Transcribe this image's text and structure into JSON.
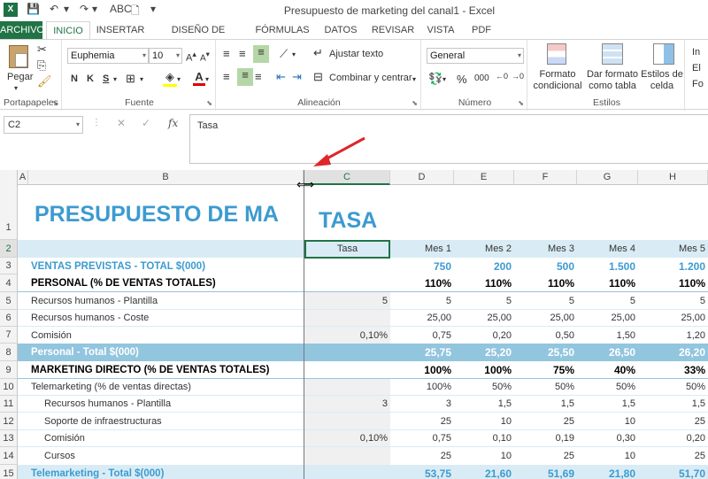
{
  "window": {
    "title": "Presupuesto de marketing del canal1 - Excel"
  },
  "quick_access": {
    "app_icon": "X",
    "save_icon": "💾",
    "undo_icon": "↶",
    "redo_icon": "↷",
    "spell_icon": "ABC",
    "newdoc_icon": "🗋",
    "dropdown": "▾"
  },
  "tabs": [
    "ARCHIVO",
    "INICIO",
    "INSERTAR",
    "DISEÑO DE PÁGINA",
    "FÓRMULAS",
    "DATOS",
    "REVISAR",
    "VISTA",
    "PDF"
  ],
  "ribbon": {
    "portapapeles": {
      "label": "Portapapeles",
      "paste": "Pegar"
    },
    "fuente": {
      "label": "Fuente",
      "font": "Euphemia",
      "size": "10",
      "bold": "N",
      "italic": "K",
      "underline": "S"
    },
    "alineacion": {
      "label": "Alineación",
      "wrap": "Ajustar texto",
      "merge": "Combinar y centrar"
    },
    "numero": {
      "label": "Número",
      "format": "General",
      "percent": "%",
      "thousands": "000"
    },
    "estilos": {
      "label": "Estilos",
      "cond": "Formato condicional",
      "table": "Dar formato como tabla",
      "cellstyles": "Estilos de celda"
    },
    "celdas": {
      "insert": "In",
      "delete": "El",
      "format": "Fo"
    }
  },
  "formula_bar": {
    "namebox": "C2",
    "fx": "fx",
    "content": "Tasa"
  },
  "columns": [
    "A",
    "B",
    "C",
    "D",
    "E",
    "F",
    "G",
    "H"
  ],
  "rows": [
    "1",
    "2",
    "3",
    "4",
    "5",
    "6",
    "7",
    "8",
    "9",
    "10",
    "11",
    "12",
    "13",
    "14",
    "15"
  ],
  "sheet": {
    "title": "PRESUPUESTO DE MA",
    "tasa_title": "TASA",
    "r2": {
      "c": "Tasa",
      "d": "Mes 1",
      "e": "Mes 2",
      "f": "Mes 3",
      "g": "Mes 4",
      "h": "Mes 5"
    },
    "r3": {
      "b": "VENTAS PREVISTAS - TOTAL $(000)",
      "d": "750",
      "e": "200",
      "f": "500",
      "g": "1.500",
      "h": "1.200"
    },
    "r4": {
      "b": "PERSONAL (% DE VENTAS TOTALES)",
      "d": "110%",
      "e": "110%",
      "f": "110%",
      "g": "110%",
      "h": "110%"
    },
    "r5": {
      "b": "Recursos humanos - Plantilla",
      "c": "5",
      "d": "5",
      "e": "5",
      "f": "5",
      "g": "5",
      "h": "5"
    },
    "r6": {
      "b": "Recursos humanos - Coste",
      "d": "25,00",
      "e": "25,00",
      "f": "25,00",
      "g": "25,00",
      "h": "25,00"
    },
    "r7": {
      "b": "Comisión",
      "c": "0,10%",
      "d": "0,75",
      "e": "0,20",
      "f": "0,50",
      "g": "1,50",
      "h": "1,20"
    },
    "r8": {
      "b": "Personal - Total $(000)",
      "d": "25,75",
      "e": "25,20",
      "f": "25,50",
      "g": "26,50",
      "h": "26,20"
    },
    "r9": {
      "b": "MARKETING DIRECTO (% DE VENTAS TOTALES)",
      "d": "100%",
      "e": "100%",
      "f": "75%",
      "g": "40%",
      "h": "33%"
    },
    "r10": {
      "b": "Telemarketing (% de ventas directas)",
      "d": "100%",
      "e": "50%",
      "f": "50%",
      "g": "50%",
      "h": "50%"
    },
    "r11": {
      "b": "Recursos humanos - Plantilla",
      "c": "3",
      "d": "3",
      "e": "1,5",
      "f": "1,5",
      "g": "1,5",
      "h": "1,5"
    },
    "r12": {
      "b": "Soporte de infraestructuras",
      "d": "25",
      "e": "10",
      "f": "25",
      "g": "10",
      "h": "25"
    },
    "r13": {
      "b": "Comisión",
      "c": "0,10%",
      "d": "0,75",
      "e": "0,10",
      "f": "0,19",
      "g": "0,30",
      "h": "0,20"
    },
    "r14": {
      "b": "Cursos",
      "d": "25",
      "e": "10",
      "f": "25",
      "g": "10",
      "h": "25"
    },
    "r15": {
      "b": "Telemarketing - Total $(000)",
      "d": "53,75",
      "e": "21,60",
      "f": "51,69",
      "g": "21,80",
      "h": "51,70"
    }
  },
  "colors": {
    "excel_green": "#217346",
    "title_blue": "#3c9bd0",
    "band_light": "#d9ecf5",
    "band_dark": "#92c5de",
    "arrow_red": "#e0252b"
  }
}
